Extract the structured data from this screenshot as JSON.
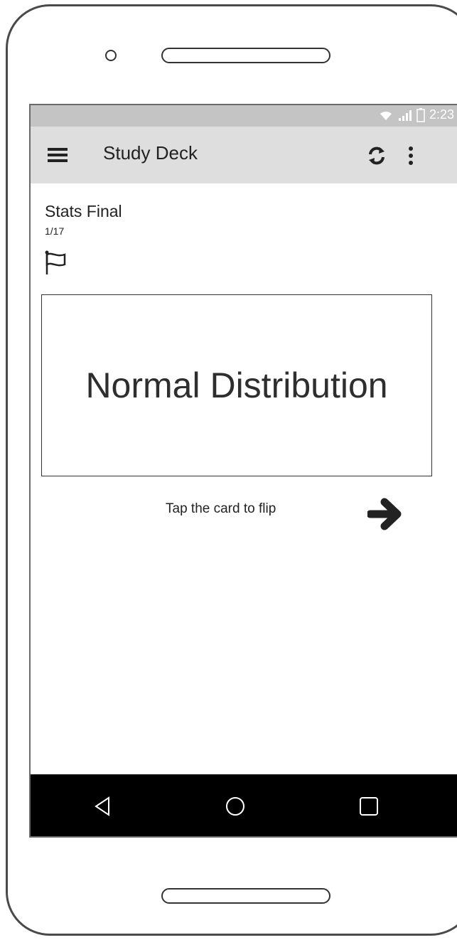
{
  "status_bar": {
    "time": "2:23"
  },
  "app_bar": {
    "title": "Study Deck"
  },
  "deck": {
    "name": "Stats Final",
    "progress": "1/17"
  },
  "card": {
    "front_text": "Normal Distribution"
  },
  "hint": "Tap the card to flip",
  "icons": {
    "menu": "hamburger-icon",
    "sync": "sync-icon",
    "more": "more-vertical-icon",
    "flag": "flag-icon",
    "next": "arrow-right-icon",
    "nav": [
      "back-icon",
      "home-icon",
      "recents-icon"
    ]
  },
  "colors": {
    "status_bar": "#c4c4c4",
    "app_bar": "#dedede",
    "nav_bar": "#000000"
  }
}
